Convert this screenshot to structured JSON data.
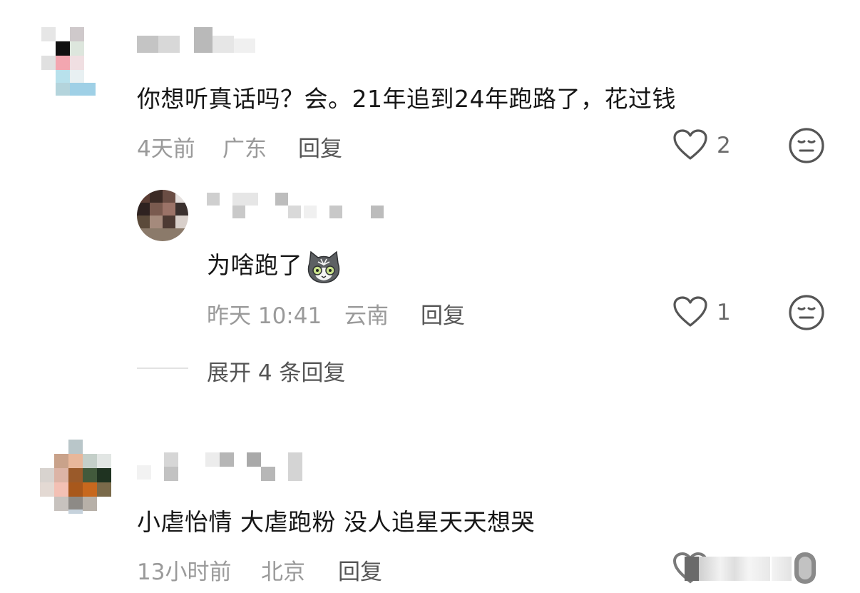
{
  "comments": [
    {
      "text": "你想听真话吗？会。21年追到24年跑路了，花过钱",
      "time": "4天前",
      "location": "广东",
      "reply_label": "回复",
      "likes": "2",
      "replies": [
        {
          "text": "为啥跑了",
          "emoji": "cat-face-emoji",
          "time": "昨天 10:41",
          "location": "云南",
          "reply_label": "回复",
          "likes": "1"
        }
      ],
      "expand_label": "展开 4 条回复"
    },
    {
      "text": "小虐怡情 大虐跑粉 没人追星天天想哭",
      "time": "13小时前",
      "location": "北京",
      "reply_label": "回复"
    }
  ],
  "icons": {
    "like": "heart-outline-icon",
    "dislike": "meh-face-icon"
  },
  "colors": {
    "text": "#161616",
    "meta": "#9a9a9a",
    "action": "#555555",
    "icon": "#555555"
  }
}
